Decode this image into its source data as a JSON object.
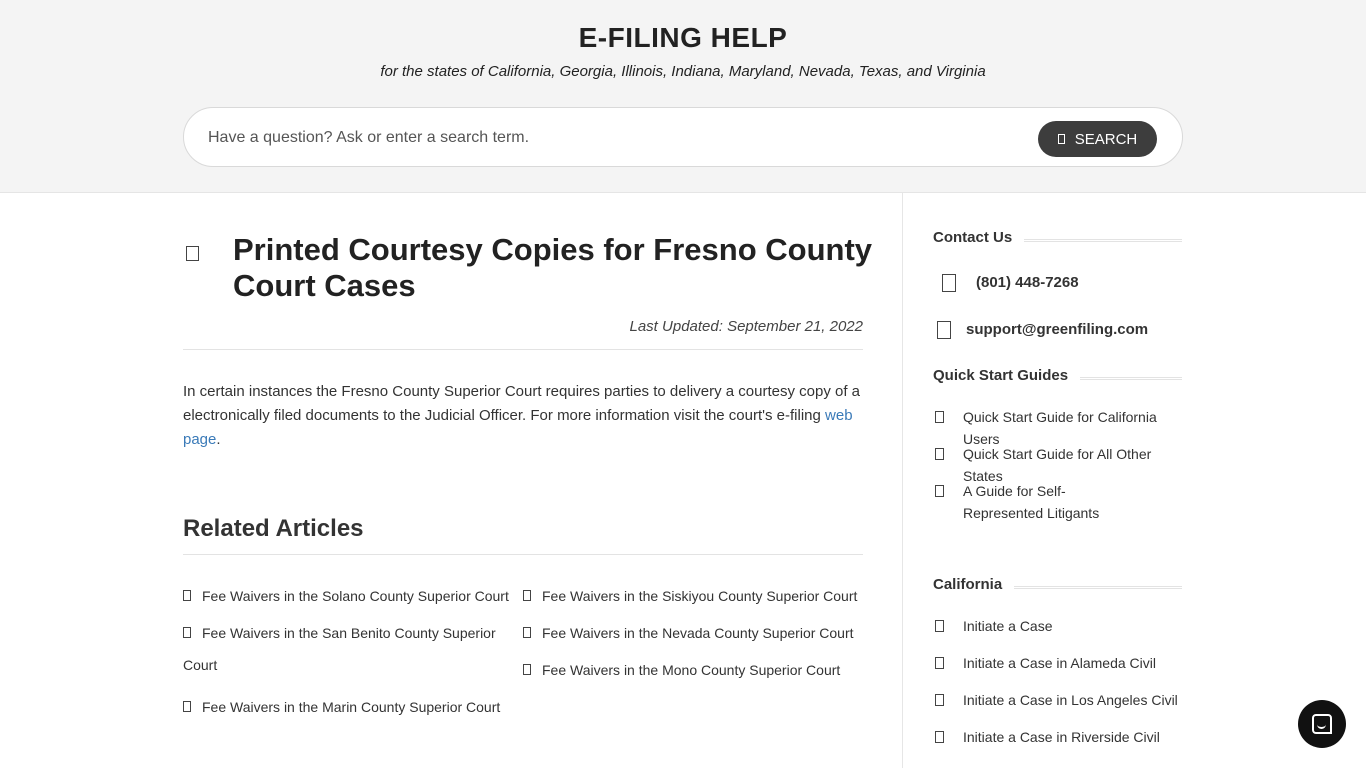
{
  "header": {
    "title": "E-FILING HELP",
    "tagline": "for the states of California, Georgia, Illinois, Indiana, Maryland, Nevada, Texas, and Virginia"
  },
  "search": {
    "placeholder": "Have a question? Ask or enter a search term.",
    "button_label": "SEARCH"
  },
  "article": {
    "title": "Printed Courtesy Copies for Fresno County Court Cases",
    "last_updated": "Last Updated: September 21, 2022",
    "body_text": "In certain instances the Fresno County Superior Court requires parties to delivery a courtesy copy of a electronically filed documents to the Judicial Officer. For more information visit the court's e-filing",
    "body_link": "web page",
    "body_end": "."
  },
  "related": {
    "title": "Related Articles",
    "items": [
      "Fee Waivers in the Solano County Superior Court",
      "Fee Waivers in the San Benito County Superior",
      "Court",
      "Fee Waivers in the Marin County Superior Court",
      "Fee Waivers in the Siskiyou County Superior Court",
      "Fee Waivers in the Nevada County Superior Court",
      "Fee Waivers in the Mono County Superior Court"
    ]
  },
  "sidebar": {
    "contact": {
      "heading": "Contact Us",
      "phone": "(801) 448-7268",
      "email": "support@greenfiling.com"
    },
    "quick_start": {
      "heading": "Quick Start Guides",
      "items": [
        "Quick Start Guide for California Users",
        "Quick Start Guide for All Other States",
        "A Guide for Self-Represented Litigants"
      ]
    },
    "california": {
      "heading": "California",
      "items": [
        "Initiate a Case",
        "Initiate a Case in Alameda Civil",
        "Initiate a Case in Los Angeles Civil",
        "Initiate a Case in Riverside Civil"
      ]
    }
  },
  "icons": {
    "search_button": "search-icon",
    "article": "document-icon",
    "phone": "phone-icon",
    "email": "envelope-icon",
    "list": "document-icon",
    "chat": "chat-icon"
  },
  "colors": {
    "header_bg": "#f4f4f4",
    "button_bg": "#3d3d3d",
    "link": "#3a7ab8",
    "chat_bg": "#111111"
  }
}
